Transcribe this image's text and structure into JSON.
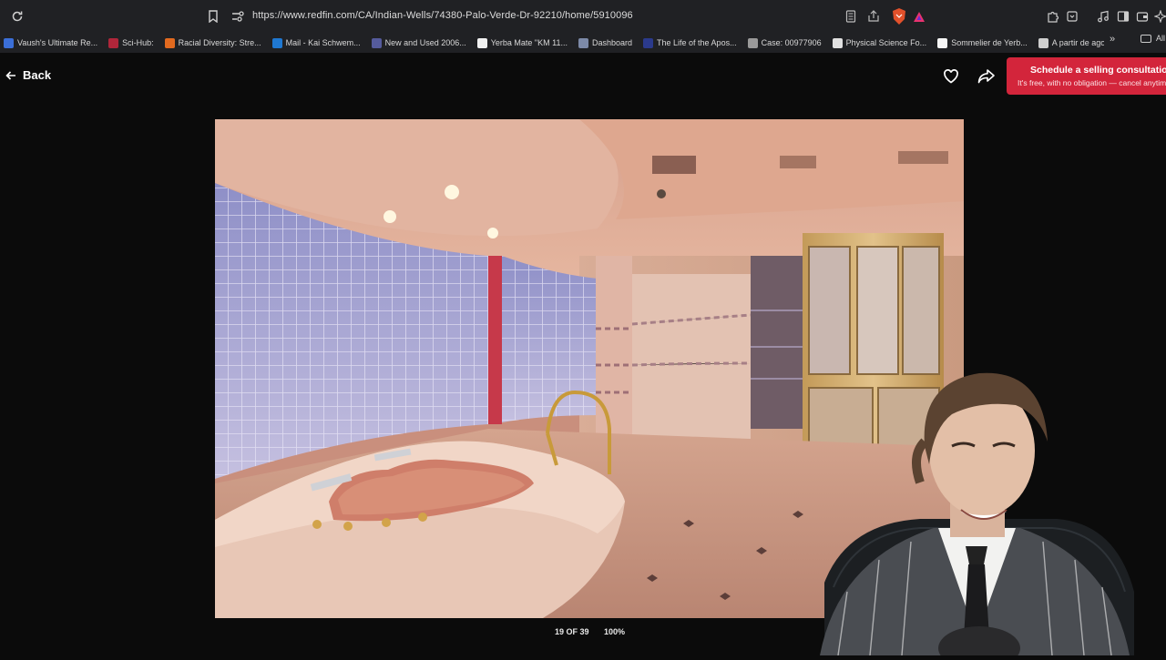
{
  "browser": {
    "url": "https://www.redfin.com/CA/Indian-Wells/74380-Palo-Verde-Dr-92210/home/5910096",
    "bookmarks": [
      {
        "label": "Vaush's Ultimate Re...",
        "color": "#3b6fd8"
      },
      {
        "label": "Sci-Hub:",
        "color": "#b0263a"
      },
      {
        "label": "Racial Diversity: Stre...",
        "color": "#e26a1f"
      },
      {
        "label": "Mail - Kai Schwem...",
        "color": "#1f78d1"
      },
      {
        "label": "New and Used 2006...",
        "color": "#555b9c"
      },
      {
        "label": "Yerba Mate \"KM 11...",
        "color": "#f0f0f0"
      },
      {
        "label": "Dashboard",
        "color": "#7d8aa8"
      },
      {
        "label": "The Life of the Apos...",
        "color": "#2b3a8c"
      },
      {
        "label": "Case: 00977906",
        "color": "#9a9a9a"
      },
      {
        "label": "Physical Science Fo...",
        "color": "#e0e0e0"
      },
      {
        "label": "Sommelier de Yerb...",
        "color": "#f5f5f5"
      },
      {
        "label": "A partir de agosto A...",
        "color": "#cfcfcf"
      }
    ],
    "all_bookmarks_label": "All"
  },
  "page": {
    "back_label": "Back",
    "cta_title": "Schedule a selling consultation",
    "cta_subtitle": "It's free, with no obligation — cancel anytime",
    "photo_counter": "19 OF 39",
    "zoom_level": "100%"
  },
  "colors": {
    "cta": "#d3253b",
    "background": "#0b0b0b"
  }
}
